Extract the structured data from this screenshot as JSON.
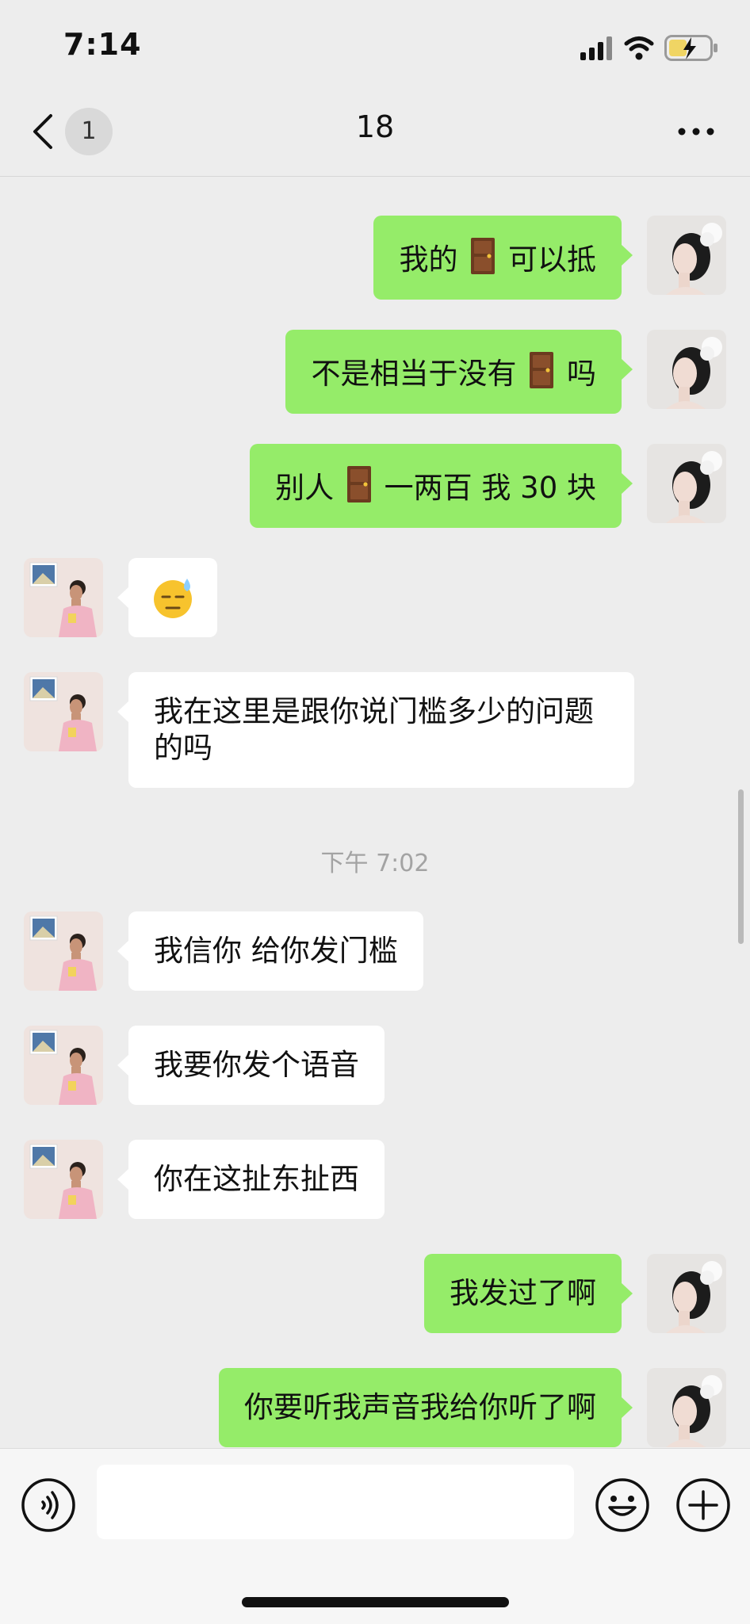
{
  "status_bar": {
    "time": "7:14"
  },
  "nav": {
    "unread_count": "1",
    "title": "18"
  },
  "messages": [
    {
      "side": "right",
      "parts": [
        "我的",
        "[door]",
        "可以抵"
      ]
    },
    {
      "side": "right",
      "parts": [
        "不是相当于没有",
        "[door]",
        "吗"
      ]
    },
    {
      "side": "right",
      "parts": [
        "别人",
        "[door]",
        "一两百 我 30 块"
      ]
    },
    {
      "side": "left",
      "parts": [
        "😓"
      ]
    },
    {
      "side": "left",
      "parts": [
        "我在这里是跟你说门槛多少的问题的吗"
      ]
    },
    {
      "side": "left",
      "parts": [
        "我信你 给你发门槛"
      ]
    },
    {
      "side": "left",
      "parts": [
        "我要你发个语音"
      ]
    },
    {
      "side": "left",
      "parts": [
        "你在这扯东扯西"
      ]
    },
    {
      "side": "right",
      "parts": [
        "我发过了啊"
      ]
    },
    {
      "side": "right",
      "parts": [
        "你要听我声音我给你听了啊"
      ]
    }
  ],
  "timestamp": "下午 7:02",
  "input": {
    "value": "",
    "placeholder": ""
  },
  "colors": {
    "background": "#ededed",
    "sent_bubble": "#95ec69",
    "received_bubble": "#ffffff",
    "timestamp_text": "#a3a3a3"
  },
  "icons": [
    "back-icon",
    "more-icon",
    "signal-icon",
    "wifi-icon",
    "battery-icon",
    "voice-icon",
    "emoji-icon",
    "plus-icon",
    "door-emoji",
    "sweat-emoji"
  ]
}
